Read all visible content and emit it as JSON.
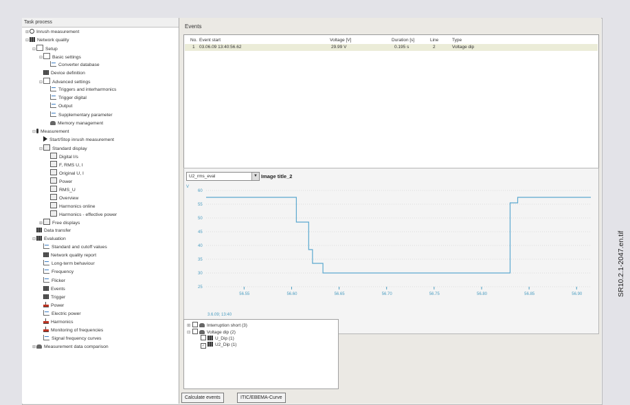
{
  "task_process": {
    "title": "Task process",
    "tree": [
      {
        "label": "Inrush measurement",
        "indent": 0,
        "icon": "search-icon",
        "exp": "+"
      },
      {
        "label": "Network quality",
        "indent": 0,
        "icon": "grid-icon",
        "exp": "−"
      },
      {
        "label": "Setup",
        "indent": 1,
        "icon": "document-icon",
        "exp": "−"
      },
      {
        "label": "Basic settings",
        "indent": 2,
        "icon": "document-icon",
        "exp": "−"
      },
      {
        "label": "Converter database",
        "indent": 3,
        "icon": "converter-icon",
        "exp": ""
      },
      {
        "label": "Device definition",
        "indent": 2,
        "icon": "device-icon",
        "exp": ""
      },
      {
        "label": "Advanced settings",
        "indent": 2,
        "icon": "document-icon",
        "exp": "−"
      },
      {
        "label": "Triggers and interharmonics",
        "indent": 3,
        "icon": "wave-icon",
        "exp": ""
      },
      {
        "label": "Trigger digital",
        "indent": 3,
        "icon": "wave-icon",
        "exp": ""
      },
      {
        "label": "Output",
        "indent": 3,
        "icon": "wave-icon",
        "exp": ""
      },
      {
        "label": "Supplementary parameter",
        "indent": 3,
        "icon": "parameter-icon",
        "exp": ""
      },
      {
        "label": "Memory management",
        "indent": 3,
        "icon": "memory-icon",
        "exp": ""
      },
      {
        "label": "Measurement",
        "indent": 1,
        "icon": "measurement-icon",
        "exp": "−"
      },
      {
        "label": "Start/Stop inrush measurement",
        "indent": 2,
        "icon": "play-icon",
        "exp": ""
      },
      {
        "label": "Standard display",
        "indent": 2,
        "icon": "display-icon",
        "exp": "−"
      },
      {
        "label": "Digital I/s",
        "indent": 3,
        "icon": "display-icon",
        "exp": ""
      },
      {
        "label": "F, RMS U, I",
        "indent": 3,
        "icon": "display-icon",
        "exp": ""
      },
      {
        "label": "Original U, I",
        "indent": 3,
        "icon": "display-icon",
        "exp": ""
      },
      {
        "label": "Power",
        "indent": 3,
        "icon": "display-icon",
        "exp": ""
      },
      {
        "label": "RMS_U",
        "indent": 3,
        "icon": "display-icon",
        "exp": ""
      },
      {
        "label": "Overview",
        "indent": 3,
        "icon": "display-icon",
        "exp": ""
      },
      {
        "label": "Harmonics online",
        "indent": 3,
        "icon": "display-icon",
        "exp": ""
      },
      {
        "label": "Harmonics - effective power",
        "indent": 3,
        "icon": "display-icon",
        "exp": ""
      },
      {
        "label": "Free displays",
        "indent": 2,
        "icon": "display-icon",
        "exp": "+"
      },
      {
        "label": "Data transfer",
        "indent": 1,
        "icon": "transfer-icon",
        "exp": ""
      },
      {
        "label": "Evaluation",
        "indent": 1,
        "icon": "grid-icon",
        "exp": "−"
      },
      {
        "label": "Standard and cutoff values",
        "indent": 2,
        "icon": "cross-icon",
        "exp": ""
      },
      {
        "label": "Network quality report",
        "indent": 2,
        "icon": "report-icon",
        "exp": ""
      },
      {
        "label": "Long-term behaviour",
        "indent": 2,
        "icon": "wave-icon",
        "exp": ""
      },
      {
        "label": "Frequency",
        "indent": 2,
        "icon": "wave-icon",
        "exp": ""
      },
      {
        "label": "Flicker",
        "indent": 2,
        "icon": "wave-icon",
        "exp": ""
      },
      {
        "label": "Events",
        "indent": 2,
        "icon": "events-icon",
        "exp": ""
      },
      {
        "label": "Trigger",
        "indent": 2,
        "icon": "trigger-icon",
        "exp": ""
      },
      {
        "label": "Power",
        "indent": 2,
        "icon": "bars-icon",
        "exp": ""
      },
      {
        "label": "Electric power",
        "indent": 2,
        "icon": "wave-icon",
        "exp": ""
      },
      {
        "label": "Harmonics",
        "indent": 2,
        "icon": "bars-icon",
        "exp": ""
      },
      {
        "label": "Monitoring of frequencies",
        "indent": 2,
        "icon": "bars-icon",
        "exp": ""
      },
      {
        "label": "Signal frequency curves",
        "indent": 2,
        "icon": "wave-icon",
        "exp": ""
      },
      {
        "label": "Measurement data comparison",
        "indent": 1,
        "icon": "compare-icon",
        "exp": "+"
      }
    ]
  },
  "events": {
    "title": "Events",
    "columns": [
      "No.",
      "Event start",
      "Voltage [V]",
      "Duration [s]",
      "Line",
      "Type"
    ],
    "rows": [
      [
        "1",
        "03.06.09 13:40:56.62",
        "29.99 V",
        "0.195 s",
        "2",
        "Voltage dip"
      ]
    ]
  },
  "chart_panel": {
    "selector_value": "U2_rms_eval",
    "image_title": "Image title_2"
  },
  "chart_data": {
    "type": "line",
    "title": "Image title_2",
    "y_unit": "V",
    "x_ticks": [
      "56.55",
      "56.60",
      "56.65",
      "56.70",
      "56.75",
      "56.80",
      "56.85",
      "56.90"
    ],
    "x_subtitle": "3.6.09; 13:40",
    "y_ticks": [
      25,
      30,
      35,
      40,
      45,
      50,
      55,
      60
    ],
    "ylim": [
      25,
      60
    ],
    "xlim": [
      56.51,
      56.915
    ],
    "series": [
      {
        "color": "#5aa8cf",
        "x": [
          56.51,
          56.605,
          56.605,
          56.618,
          56.618,
          56.622,
          56.622,
          56.633,
          56.633,
          56.83,
          56.83,
          56.838,
          56.838,
          56.915
        ],
        "y": [
          57.5,
          57.5,
          48.5,
          48.5,
          38.5,
          38.5,
          33.5,
          33.5,
          30,
          30,
          55.5,
          55.5,
          57.5,
          57.5
        ]
      }
    ]
  },
  "event_tree": [
    {
      "label": "Interruption short (3)",
      "indent": 0,
      "exp": "+",
      "checked": false
    },
    {
      "label": "Voltage dip (2)",
      "indent": 0,
      "exp": "−",
      "checked": false
    },
    {
      "label": "U_Dip (1)",
      "indent": 1,
      "exp": "",
      "checked": false
    },
    {
      "label": "U2_Dip (1)",
      "indent": 1,
      "exp": "",
      "checked": true
    }
  ],
  "buttons": {
    "calculate": "Calculate events",
    "itic": "ITIC/EBEMA-Curve"
  },
  "side_label": "SR10.2.1-2047.en.tif"
}
